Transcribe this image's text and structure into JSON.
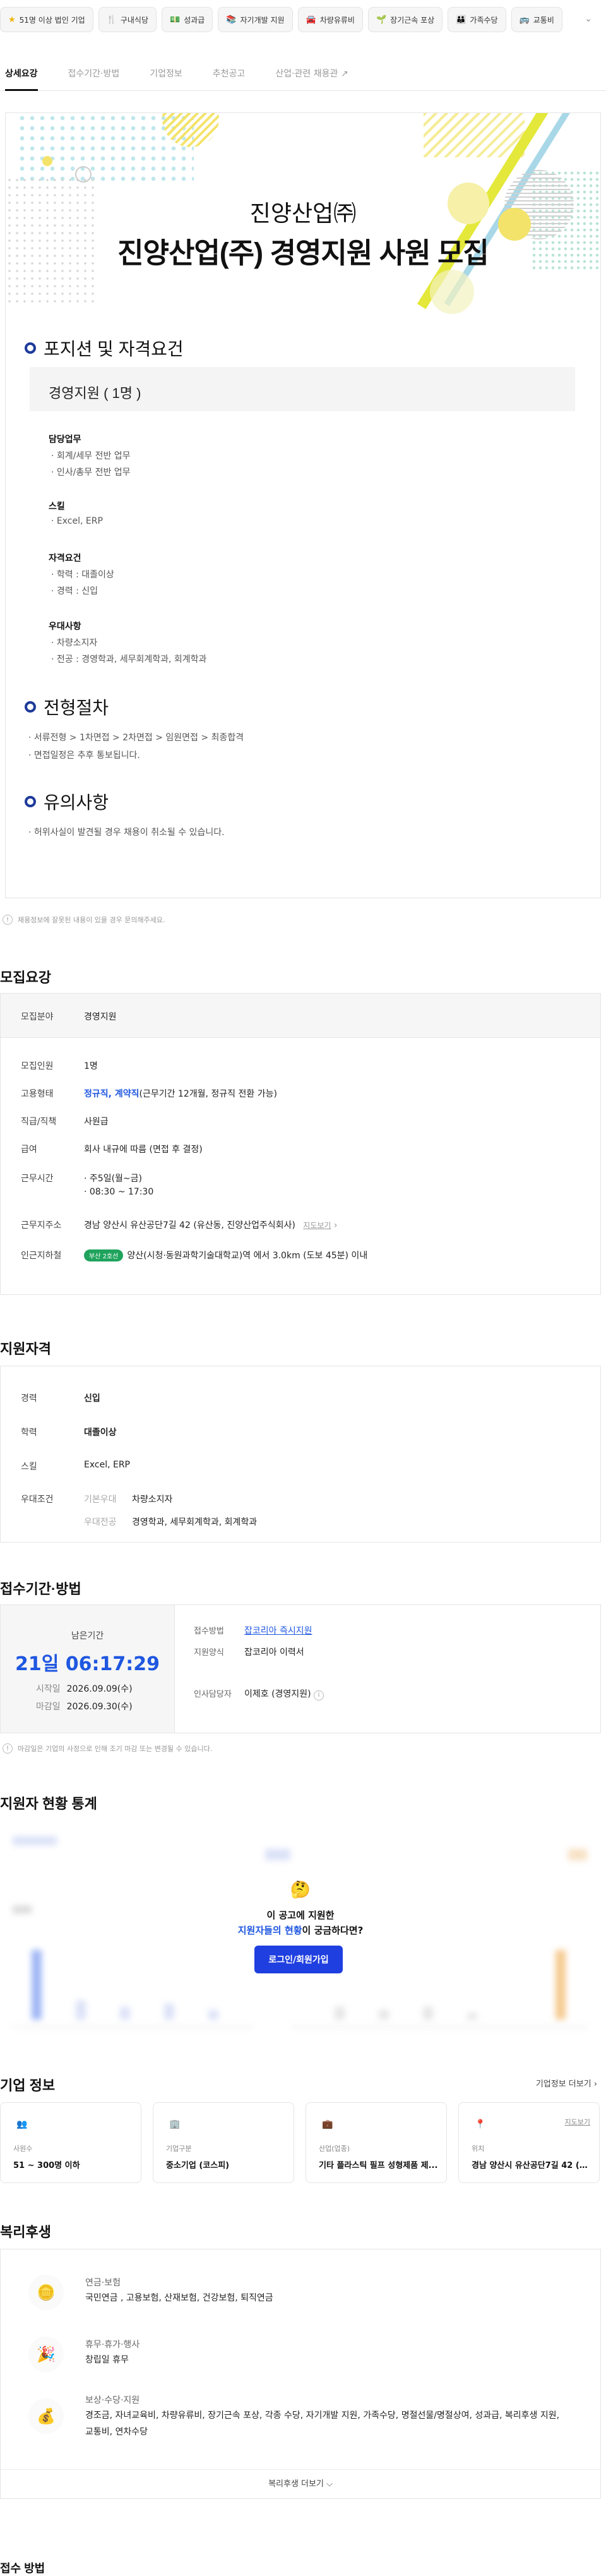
{
  "tags": [
    {
      "icon": "star-icon",
      "glyph": "★",
      "color": "#f0b400",
      "label": "51명 이상 법인 기업"
    },
    {
      "icon": "fork-icon",
      "glyph": "🍴",
      "color": "#555",
      "label": "구내식당"
    },
    {
      "icon": "money-icon",
      "glyph": "💵",
      "color": "#3a9a3a",
      "label": "성과급"
    },
    {
      "icon": "book-icon",
      "glyph": "📚",
      "color": "#a33",
      "label": "자기개발 지원"
    },
    {
      "icon": "car-icon",
      "glyph": "🚘",
      "color": "#d44",
      "label": "차량유류비"
    },
    {
      "icon": "plant-icon",
      "glyph": "🌱",
      "color": "#3a9a3a",
      "label": "장기근속 포상"
    },
    {
      "icon": "family-icon",
      "glyph": "👨‍👩‍👧",
      "color": "#555",
      "label": "가족수당"
    },
    {
      "icon": "bus-icon",
      "glyph": "🚌",
      "color": "#336",
      "label": "교통비"
    }
  ],
  "tabs": [
    "상세요강",
    "접수기간·방법",
    "기업정보",
    "추천공고",
    "산업·관련 채용관"
  ],
  "hero": {
    "company": "진양산업㈜",
    "title": "진양산업(주) 경영지원 사원 모집"
  },
  "position": {
    "heading": "포지션 및 자격요건",
    "box_title": "경영지원 ( 1명 )",
    "groups": [
      {
        "title": "담당업무",
        "items": [
          "· 회계/세무 전반 업무",
          "· 인사/총무 전반 업무"
        ]
      },
      {
        "title": "스킬",
        "items": [
          "· Excel, ERP"
        ]
      },
      {
        "title": "자격요건",
        "items": [
          "· 학력 : 대졸이상",
          "· 경력 : 신입"
        ]
      },
      {
        "title": "우대사항",
        "items": [
          "· 차량소지자",
          "· 전공 : 경영학과, 세무회계학과, 회계학과"
        ]
      }
    ]
  },
  "process": {
    "heading": "전형절차",
    "items": [
      "· 서류전형 > 1차면접 > 2차면접 > 임원면접 > 최종합격",
      "· 면접일정은 추후 통보됩니다."
    ]
  },
  "caution": {
    "heading": "유의사항",
    "items": [
      "· 허위사실이 발견될 경우 채용이 취소될 수 있습니다."
    ]
  },
  "detail_notice": "채용정보에 잘못된 내용이 있을 경우 문의해주세요.",
  "summary": {
    "heading": "모집요강",
    "field_label": "모집분야",
    "field_value": "경영지원",
    "rows": {
      "count_label": "모집인원",
      "count_value": "1명",
      "type_label": "고용형태",
      "type_value_bold": "정규직, 계약직",
      "type_value_rest": "(근무기간 12개월, 정규직 전환 가능)",
      "rank_label": "직급/직책",
      "rank_value": "사원급",
      "salary_label": "급여",
      "salary_value": "회사 내규에 따름 (면접 후 결정)",
      "time_label": "근무시간",
      "time_value_1": "· 주5일(월~금)",
      "time_value_2": "· 08:30 ~ 17:30",
      "address_label": "근무지주소",
      "address_value": "경남 양산시 유산공단7길 42 (유산동, 진양산업주식회사)",
      "map_link": "지도보기",
      "station_label": "인근지하철",
      "station_badge": "부산 2호선",
      "station_value": "양산(시청·동원과학기술대학교)역 에서 3.0km (도보 45분) 이내"
    }
  },
  "qualify": {
    "heading": "지원자격",
    "career_label": "경력",
    "career_value": "신입",
    "edu_label": "학력",
    "edu_value": "대졸이상",
    "skill_label": "스킬",
    "skill_value": "Excel, ERP",
    "pref_label": "우대조건",
    "pref_basic_label": "기본우대",
    "pref_basic_value": "차량소지자",
    "pref_major_label": "우대전공",
    "pref_major_value": "경영학과, 세무회계학과, 회계학과"
  },
  "period": {
    "heading": "접수기간·방법",
    "remain_label": "남은기간",
    "remain_value": "21일 06:17:29",
    "start_label": "시작일",
    "start_value": "2026.09.09(수)",
    "end_label": "마감일",
    "end_value": "2026.09.30(수)",
    "method_label": "접수방법",
    "method_value": "잡코리아 즉시지원",
    "form_label": "지원양식",
    "form_value": "잡코리아 이력서",
    "hr_label": "인사담당자",
    "hr_value": "이제호 (경영지원)",
    "notice": "마감일은 기업의 사정으로 인해 조기 마감 또는 변경될 수 있습니다."
  },
  "stats": {
    "heading": "지원자 현황 통계",
    "prompt_1": "이 공고에 지원한",
    "prompt_2_bold": "지원자들의 현황",
    "prompt_2_rest": "이 궁금하다면?",
    "login_button": "로그인/회원가입",
    "emoji": "🤔"
  },
  "company": {
    "heading": "기업 정보",
    "more": "기업정보 더보기 ›",
    "cards": [
      {
        "icon": "people-icon",
        "glyph": "👥",
        "label": "사원수",
        "value": "51 ~ 300명 이하"
      },
      {
        "icon": "building-icon",
        "glyph": "🏢",
        "label": "기업구분",
        "value": "중소기업 (코스피)"
      },
      {
        "icon": "briefcase-icon",
        "glyph": "💼",
        "label": "산업(업종)",
        "value": "기타 플라스틱 필프 성형제품 제..."
      },
      {
        "icon": "location-pin-icon",
        "glyph": "📍",
        "label": "위치",
        "value": "경남 양산시 유산공단7길 42 (유...",
        "extra": "지도보기"
      }
    ]
  },
  "welfare": {
    "heading": "복리후생",
    "items": [
      {
        "icon": "pension-icon",
        "glyph": "🪙",
        "title": "연금·보험",
        "value": "국민연금 , 고용보험, 산재보험, 건강보험, 퇴직연금"
      },
      {
        "icon": "party-icon",
        "glyph": "🎉",
        "title": "휴무·휴가·행사",
        "value": "창립일 휴무"
      },
      {
        "icon": "money-bag-icon",
        "glyph": "💰",
        "title": "보상·수당·지원",
        "value": "경조금, 자녀교육비, 차량유류비, 장기근속 포상, 각종 수당, 자기개발 지원, 가족수당, 명절선물/명절상여, 성과급, 복리후생 지원, 교통비, 연차수당"
      }
    ],
    "more": "복리후생 더보기 ⌵"
  },
  "footer_peek": "접수 방법"
}
